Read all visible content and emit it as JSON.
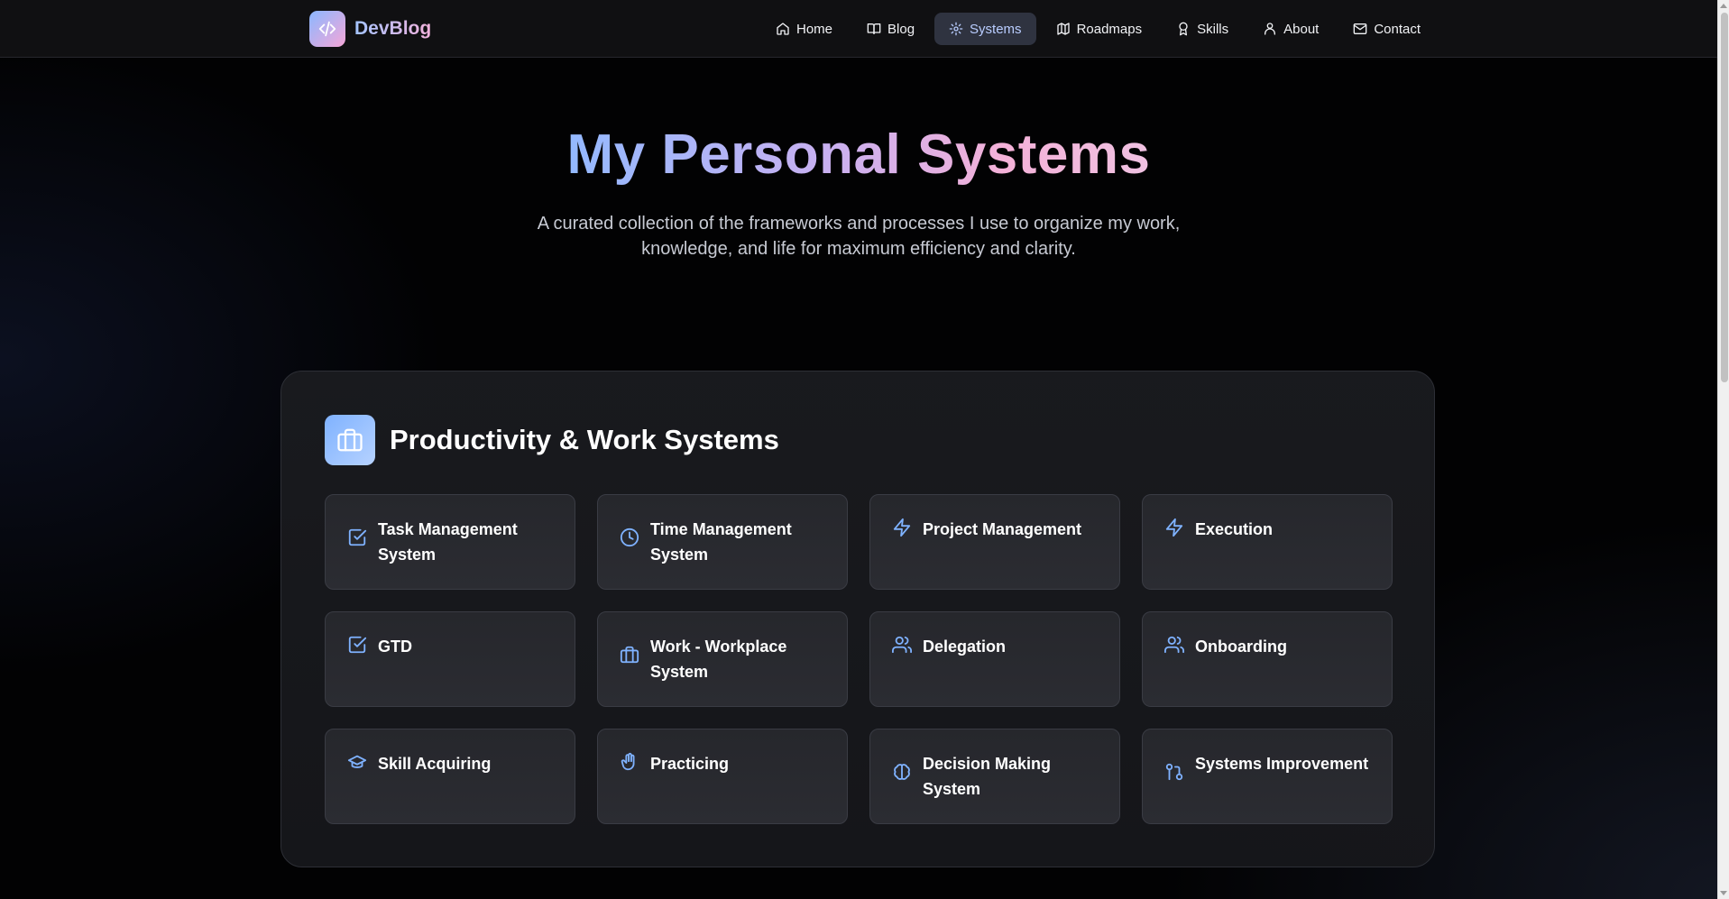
{
  "brand": {
    "name": "DevBlog",
    "logo_icon": "code-icon"
  },
  "nav": {
    "items": [
      {
        "label": "Home",
        "icon": "home-icon",
        "active": false
      },
      {
        "label": "Blog",
        "icon": "book-icon",
        "active": false
      },
      {
        "label": "Systems",
        "icon": "gear-icon",
        "active": true
      },
      {
        "label": "Roadmaps",
        "icon": "map-icon",
        "active": false
      },
      {
        "label": "Skills",
        "icon": "award-icon",
        "active": false
      },
      {
        "label": "About",
        "icon": "user-icon",
        "active": false
      },
      {
        "label": "Contact",
        "icon": "mail-icon",
        "active": false
      }
    ]
  },
  "hero": {
    "title": "My Personal Systems",
    "subtitle": "A curated collection of the frameworks and processes I use to organize my work, knowledge, and life for maximum efficiency and clarity."
  },
  "section": {
    "title": "Productivity & Work Systems",
    "icon": "briefcase-icon",
    "cards": [
      {
        "title": "Task Management System",
        "icon": "check-square-icon"
      },
      {
        "title": "Time Management System",
        "icon": "clock-icon"
      },
      {
        "title": "Project Management",
        "icon": "zap-icon"
      },
      {
        "title": "Execution",
        "icon": "zap-icon"
      },
      {
        "title": "GTD",
        "icon": "check-square-icon"
      },
      {
        "title": "Work - Workplace System",
        "icon": "briefcase-icon"
      },
      {
        "title": "Delegation",
        "icon": "users-icon"
      },
      {
        "title": "Onboarding",
        "icon": "users-icon"
      },
      {
        "title": "Skill Acquiring",
        "icon": "graduation-cap-icon"
      },
      {
        "title": "Practicing",
        "icon": "hand-icon"
      },
      {
        "title": "Decision Making System",
        "icon": "brain-icon"
      },
      {
        "title": "Systems Improvement",
        "icon": "git-pull-request-icon"
      }
    ]
  },
  "colors": {
    "accent": "#7fb2ff",
    "active_nav_bg": "#2f3340",
    "card_bg": "#26272c"
  }
}
